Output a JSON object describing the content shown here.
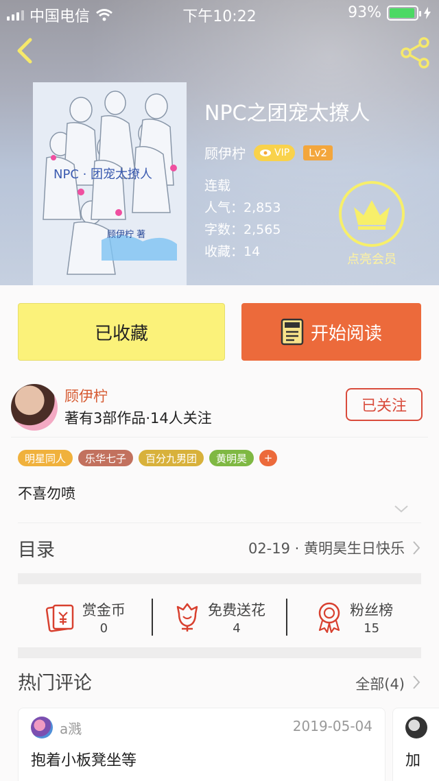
{
  "status_bar": {
    "carrier": "中国电信",
    "time": "下午10:22",
    "battery": "93%"
  },
  "book": {
    "title": "NPC之团宠太撩人",
    "author": "顾伊柠",
    "vip_label": "VIP",
    "level": "Lv2",
    "status": "连载",
    "popularity_label": "人气：",
    "popularity": "2,853",
    "words_label": "字数：",
    "words": "2,565",
    "collect_label": "收藏：",
    "collect": "14",
    "member_label": "点亮会员"
  },
  "actions": {
    "favorited_label": "已收藏",
    "read_label": "开始阅读"
  },
  "author_card": {
    "name": "顾伊柠",
    "stats": "著有3部作品·14人关注",
    "follow_label": "已关注"
  },
  "tags": [
    {
      "label": "明星同人",
      "color": "#f0b13c"
    },
    {
      "label": "乐华七子",
      "color": "#c2715e"
    },
    {
      "label": "百分九男团",
      "color": "#d8b13b"
    },
    {
      "label": "黄明昊",
      "color": "#7fb843"
    },
    {
      "label": "+",
      "color": "#ec6a3b"
    }
  ],
  "intro": "不喜勿喷",
  "toc": {
    "label": "目录",
    "latest": "02-19 · 黄明昊生日快乐"
  },
  "stats": [
    {
      "title": "赏金币",
      "value": "0",
      "icon": "coin-envelope-icon"
    },
    {
      "title": "免费送花",
      "value": "4",
      "icon": "flower-icon"
    },
    {
      "title": "粉丝榜",
      "value": "15",
      "icon": "badge-ribbon-icon"
    }
  ],
  "comments": {
    "label": "热门评论",
    "all_label": "全部(4)",
    "items": [
      {
        "user": "a溅",
        "date": "2019-05-04",
        "text": "抱着小板凳坐等"
      },
      {
        "text": "加"
      }
    ]
  },
  "colors": {
    "accent_orange": "#ec6a3b",
    "fav_yellow": "#fbf27a",
    "follow_red": "#d94b3b"
  }
}
